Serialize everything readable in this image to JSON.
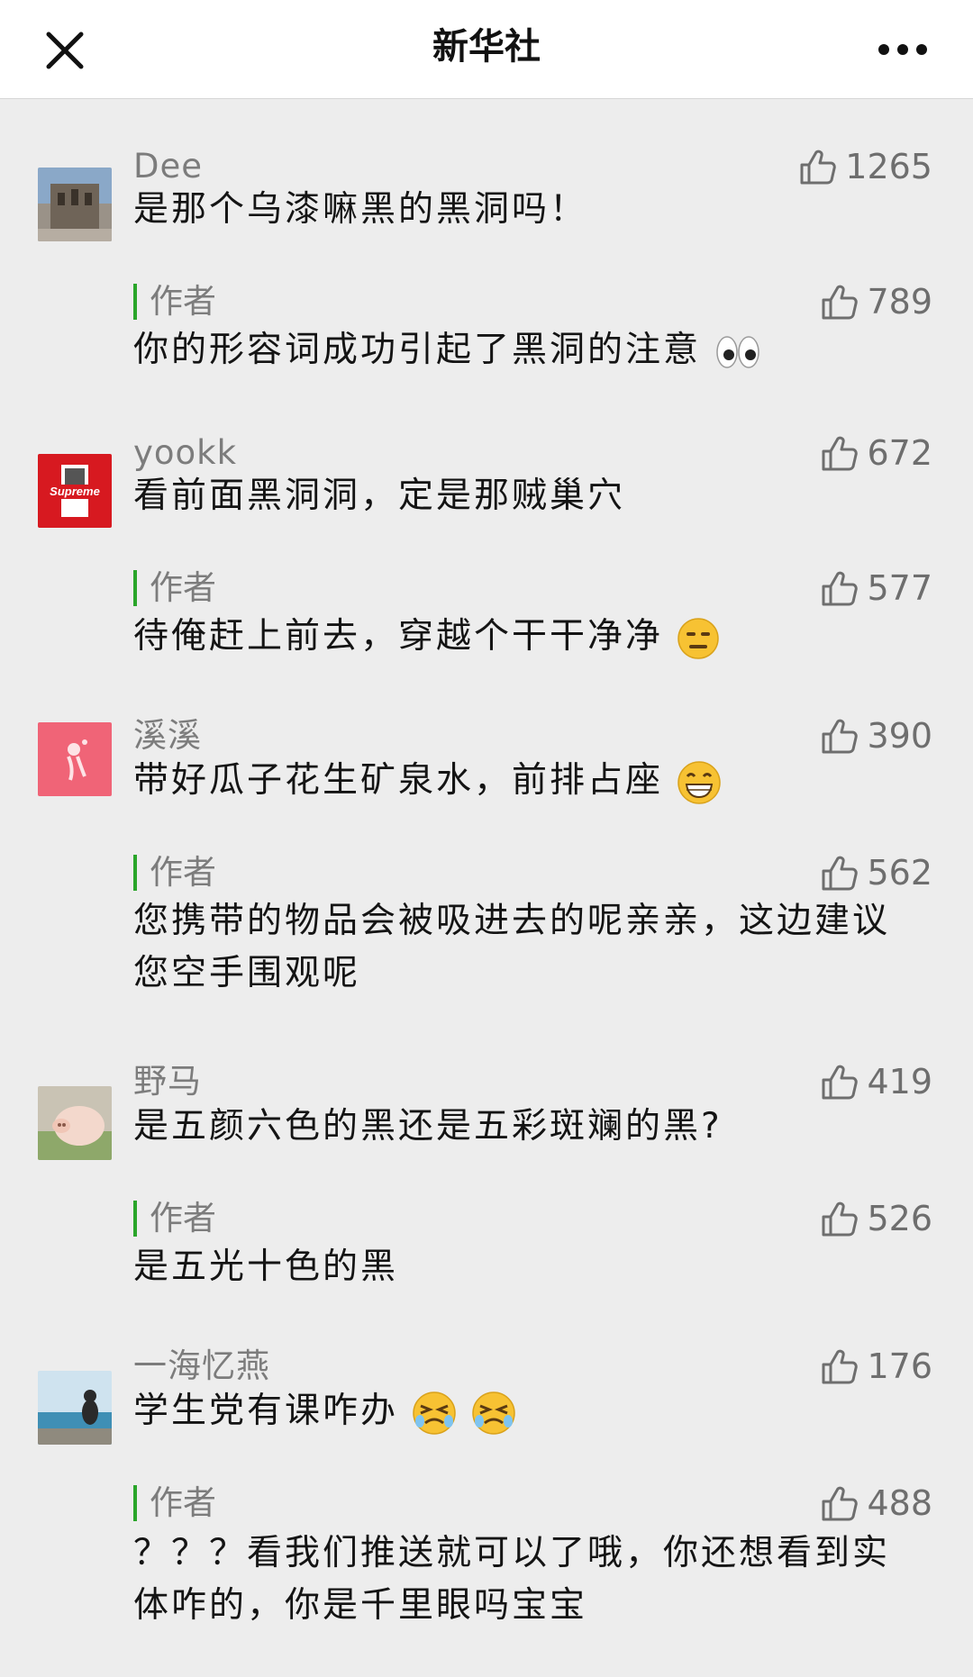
{
  "header": {
    "title": "新华社"
  },
  "comments": [
    {
      "nick": "Dee",
      "text": "是那个乌漆嘛黑的黑洞吗！",
      "likes": "1265",
      "reply": {
        "tag": "作者",
        "text": "你的形容词成功引起了黑洞的注意",
        "likes": "789"
      }
    },
    {
      "nick": "yookk",
      "text": "看前面黑洞洞，定是那贼巢穴",
      "likes": "672",
      "reply": {
        "tag": "作者",
        "text": "待俺赶上前去，穿越个干干净净",
        "likes": "577"
      }
    },
    {
      "nick": "溪溪",
      "text": "带好瓜子花生矿泉水，前排占座",
      "likes": "390",
      "reply": {
        "tag": "作者",
        "text_line1": "您携带的物品会被吸进去的呢亲亲，这边建议",
        "text_line2": "您空手围观呢",
        "likes": "562"
      }
    },
    {
      "nick": "野马",
      "text": "是五颜六色的黑还是五彩斑斓的黑?",
      "likes": "419",
      "reply": {
        "tag": "作者",
        "text": "是五光十色的黑",
        "likes": "526"
      }
    },
    {
      "nick": "一海忆燕",
      "text": "学生党有课咋办",
      "likes": "176",
      "reply": {
        "tag": "作者",
        "text_line1": "？？？看我们推送就可以了哦，你还想看到实",
        "text_line2": "体咋的，你是千里眼吗宝宝",
        "likes": "488"
      }
    }
  ],
  "icons": {
    "close": "close-icon",
    "more": "more-dots-icon",
    "like": "thumbs-up-icon",
    "emoji_eyes": "eyes-emoji",
    "emoji_expressionless": "expressionless-emoji",
    "emoji_grin": "grinning-emoji",
    "emoji_crying": "crying-emoji"
  },
  "colors": {
    "author_bar": "#2aa52a",
    "background": "#ededed",
    "topbar": "#ffffff"
  }
}
